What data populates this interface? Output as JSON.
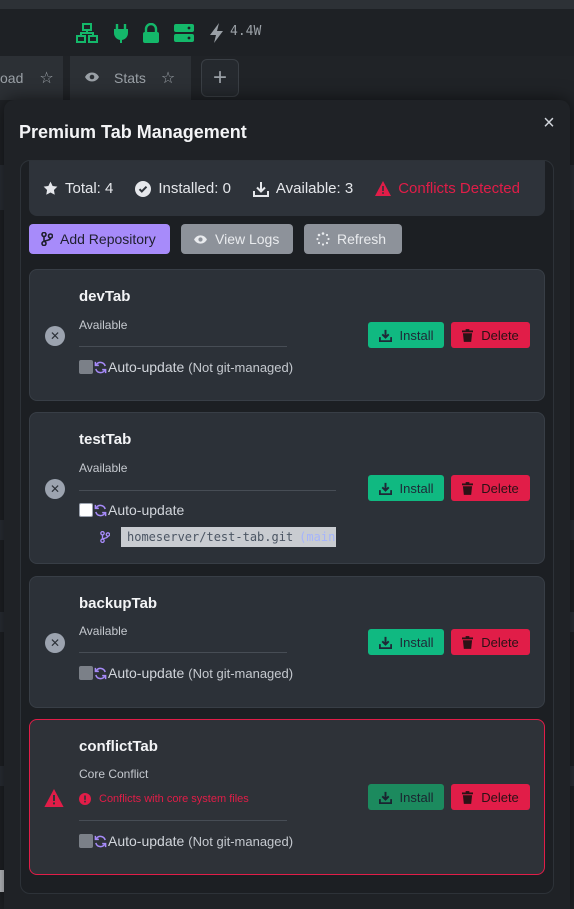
{
  "statusbar": {
    "power": "4.4W",
    "icons": [
      "network-icon",
      "plug-icon",
      "lock-icon",
      "server-icon",
      "bolt-icon"
    ]
  },
  "tabs": [
    {
      "label": "oad",
      "icon": "star-icon"
    },
    {
      "label": "Stats",
      "icon": "eye-icon",
      "star": "star-icon"
    }
  ],
  "modal": {
    "title": "Premium Tab Management",
    "close": "×"
  },
  "stats": {
    "total": "Total: 4",
    "installed": "Installed: 0",
    "available": "Available: 3",
    "conflicts": "Conflicts Detected"
  },
  "actions": {
    "add_repository": "Add Repository",
    "view_logs": "View Logs",
    "refresh": "Refresh"
  },
  "tabs_list": [
    {
      "name": "devTab",
      "status": "Available",
      "auto_update": "Auto-update",
      "note": "(Not git-managed)",
      "install": "Install",
      "delete": "Delete"
    },
    {
      "name": "testTab",
      "status": "Available",
      "auto_update": "Auto-update",
      "repo_url": "homeserver/test-tab.git",
      "branch": "(main)",
      "install": "Install",
      "delete": "Delete"
    },
    {
      "name": "backupTab",
      "status": "Available",
      "auto_update": "Auto-update",
      "note": "(Not git-managed)",
      "install": "Install",
      "delete": "Delete"
    },
    {
      "name": "conflictTab",
      "status": "Core Conflict",
      "error": "Conflicts with core system files",
      "auto_update": "Auto-update",
      "note": "(Not git-managed)",
      "install": "Install",
      "delete": "Delete"
    }
  ],
  "colors": {
    "accent": "#a78bfa",
    "install": "#10b981",
    "danger": "#e11d48",
    "status_green": "#14b86a"
  }
}
